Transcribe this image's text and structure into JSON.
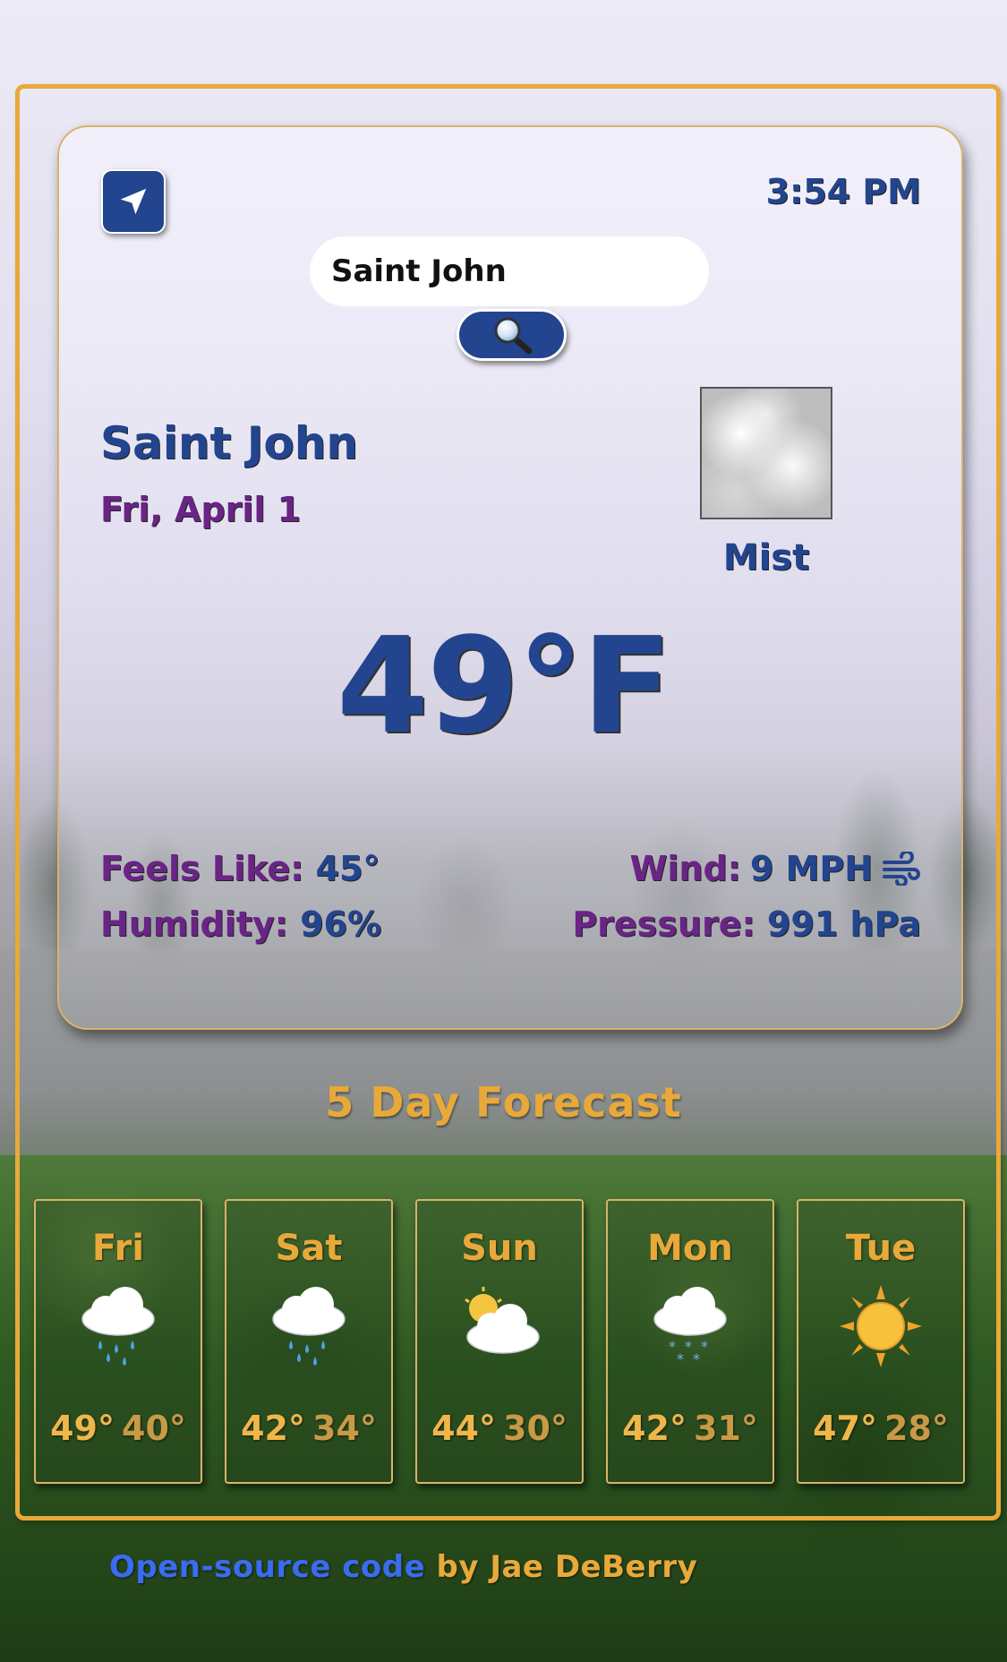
{
  "header": {
    "time": "3:54 PM",
    "location_button_icon": "navigation-arrow-icon"
  },
  "search": {
    "value": "Saint John",
    "button_icon": "magnifier-icon"
  },
  "current": {
    "city": "Saint John",
    "date": "Fri, April 1",
    "condition": "Mist",
    "condition_icon": "mist-icon",
    "temperature": "49°F",
    "feels_like_label": "Feels Like:",
    "feels_like_value": "45°",
    "humidity_label": "Humidity:",
    "humidity_value": "96%",
    "wind_label": "Wind:",
    "wind_value": "9 MPH",
    "wind_icon": "wind-icon",
    "pressure_label": "Pressure:",
    "pressure_value": "991 hPa"
  },
  "forecast": {
    "title": "5 Day Forecast",
    "days": [
      {
        "day": "Fri",
        "icon": "rain-cloud-icon",
        "high": "49°",
        "low": "40°"
      },
      {
        "day": "Sat",
        "icon": "rain-cloud-icon",
        "high": "42°",
        "low": "34°"
      },
      {
        "day": "Sun",
        "icon": "sun-behind-cloud-icon",
        "high": "44°",
        "low": "30°"
      },
      {
        "day": "Mon",
        "icon": "snow-cloud-icon",
        "high": "42°",
        "low": "31°"
      },
      {
        "day": "Tue",
        "icon": "sun-icon",
        "high": "47°",
        "low": "28°"
      }
    ]
  },
  "footer": {
    "link_text": "Open-source code",
    "suffix_text": " by Jae DeBerry"
  },
  "colors": {
    "accent_gold": "#e8a93a",
    "primary_blue": "#23458f",
    "label_purple": "#6a2486",
    "link_blue": "#3a6cf0"
  }
}
